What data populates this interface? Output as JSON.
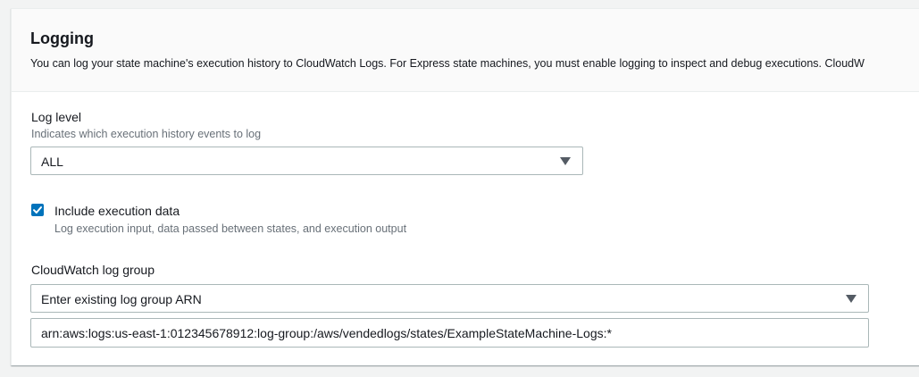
{
  "section": {
    "title": "Logging",
    "description": "You can log your state machine's execution history to CloudWatch Logs. For Express state machines, you must enable logging to inspect and debug executions. CloudW"
  },
  "log_level": {
    "label": "Log level",
    "description": "Indicates which execution history events to log",
    "selected": "ALL",
    "caret_icon": "caret-down-icon"
  },
  "include_execution_data": {
    "checked": true,
    "label": "Include execution data",
    "description": "Log execution input, data passed between states, and execution output",
    "check_icon": "checkmark-icon"
  },
  "log_group": {
    "label": "CloudWatch log group",
    "selected": "Enter existing log group ARN",
    "caret_icon": "caret-down-icon",
    "arn_value": "arn:aws:logs:us-east-1:012345678912:log-group:/aws/vendedlogs/states/ExampleStateMachine-Logs:*"
  },
  "colors": {
    "accent": "#0073bb",
    "text": "#16191f",
    "secondary_text": "#687078",
    "border": "#aab7b8",
    "background": "#f2f3f3"
  }
}
